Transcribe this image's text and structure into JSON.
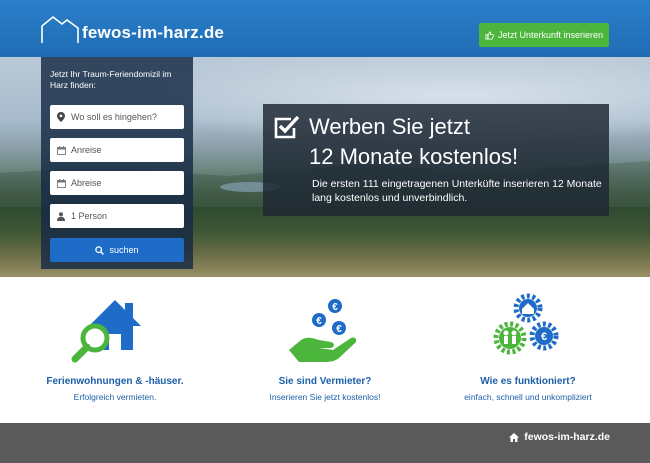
{
  "header": {
    "logo_text": "fewos-im-harz.de",
    "cta_label": "Jetzt Unterkunft inserieren",
    "cta_icon": "thumbs-up-icon"
  },
  "search": {
    "intro": "Jetzt Ihr Traum-Feriendomizil im Harz finden:",
    "destination_placeholder": "Wo soll es hingehen?",
    "arrival_placeholder": "Anreise",
    "departure_placeholder": "Abreise",
    "guests_value": "1 Person",
    "button_label": "suchen"
  },
  "promo": {
    "title_line1": "Werben Sie jetzt",
    "title_line2": "12 Monate kostenlos!",
    "description": "Die ersten 111 eingetragenen Unterküfte inserieren 12 Monate lang kostenlos und unverbindlich."
  },
  "features": [
    {
      "title": "Ferienwohnungen & -häuser.",
      "subtitle": "Erfolgreich vermieten.",
      "icon": "house-search-icon"
    },
    {
      "title": "Sie sind Vermieter?",
      "subtitle": "Inserieren Sie jetzt kostenlos!",
      "icon": "hand-euro-coins-icon"
    },
    {
      "title": "Wie es funktioniert?",
      "subtitle": "einfach, schnell und unkompliziert",
      "icon": "gears-icon"
    }
  ],
  "footer": {
    "brand": "fewos-im-harz.de"
  },
  "colors": {
    "header_blue": "#1f6cb4",
    "cta_green": "#4cb63c",
    "search_blue": "#1f6cc8",
    "feature_text": "#1d5fa8",
    "footer_gray": "#5a5a5a"
  }
}
